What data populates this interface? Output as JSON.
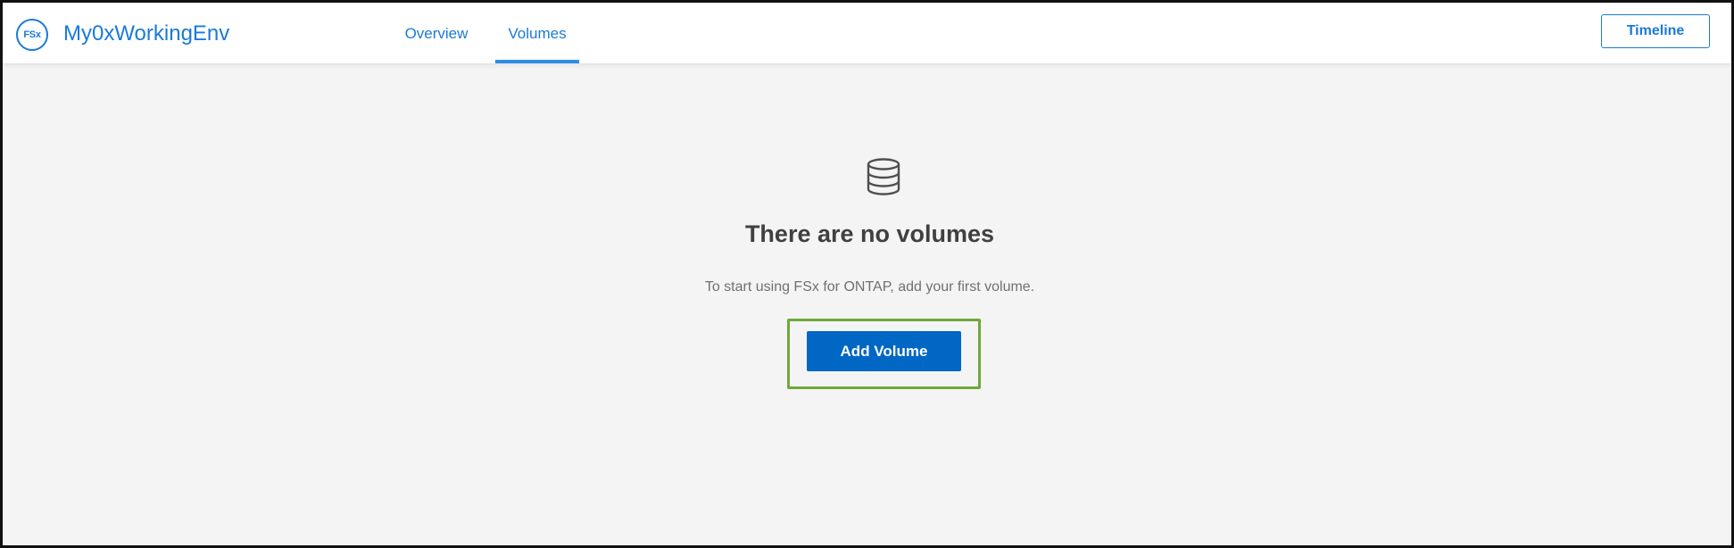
{
  "header": {
    "logo_text": "FSx",
    "logo_icon": "fsx-logo-icon",
    "env_title": "My0xWorkingEnv",
    "tabs": [
      {
        "label": "Overview",
        "active": false
      },
      {
        "label": "Volumes",
        "active": true
      }
    ],
    "timeline_label": "Timeline"
  },
  "empty_state": {
    "icon": "database-icon",
    "title": "There are no volumes",
    "subtitle": "To start using FSx for ONTAP, add your first volume.",
    "add_button_label": "Add Volume"
  },
  "colors": {
    "accent": "#1a7ad9",
    "primary_button": "#0067c5",
    "highlight_box": "#6fa83a",
    "background": "#f4f4f4"
  }
}
